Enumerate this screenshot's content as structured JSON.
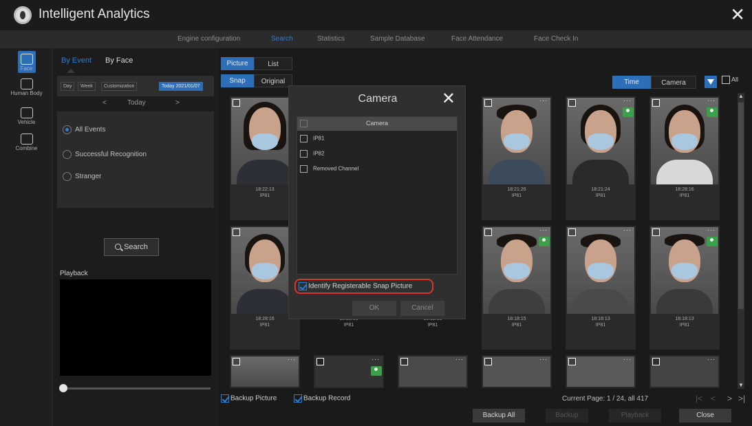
{
  "app": {
    "title": "Intelligent Analytics"
  },
  "nav": {
    "tabs": [
      "Engine configuration",
      "Search",
      "Statistics",
      "Sample Database",
      "Face Attendance",
      "Face Check In"
    ],
    "active": "Search"
  },
  "sidebar": {
    "items": [
      "Face",
      "Human Body",
      "Vehicle",
      "Combine"
    ],
    "active": "Face"
  },
  "panel": {
    "tab_event": "By Event",
    "tab_face": "By Face",
    "range_buttons": [
      "Day",
      "Week",
      "Customization",
      "Today 2021/01/07"
    ],
    "date_label": "Today",
    "prev": "<",
    "next": ">",
    "radio": [
      "All Events",
      "Successful Recognition",
      "Stranger"
    ],
    "radio_selected": "All Events",
    "search_label": "Search",
    "playback_label": "Playback"
  },
  "main": {
    "view_tabs": [
      "Picture",
      "List"
    ],
    "image_tabs": [
      "Snap",
      "Original"
    ],
    "sort_tabs": [
      "Time",
      "Camera"
    ],
    "all_label": "All",
    "thumbs_row1": [
      {
        "time": "18:22:13",
        "cam": "IP81"
      },
      {
        "time": "18:21:26",
        "cam": "IP81"
      },
      {
        "time": "18:21:24",
        "cam": "IP81"
      },
      {
        "time": "18:28:16",
        "cam": "IP81"
      }
    ],
    "thumbs_row2": [
      {
        "time": "18:28:16",
        "cam": "IP81"
      },
      {
        "time": "18:28:06",
        "cam": "IP81"
      },
      {
        "time": "18:12:16",
        "cam": "IP81"
      },
      {
        "time": "18:18:15",
        "cam": "IP81"
      },
      {
        "time": "18:18:13",
        "cam": "IP81"
      },
      {
        "time": "18:18:13",
        "cam": "IP81"
      }
    ],
    "thumb_menu": "···",
    "backup_picture": "Backup Picture",
    "backup_record": "Backup Record",
    "page_info": "Current Page: 1 / 24, all 417",
    "buttons": [
      "Backup All",
      "Backup",
      "Playback",
      "Close"
    ]
  },
  "modal": {
    "title": "Camera",
    "list_header": "Camera",
    "cameras": [
      "IP81",
      "IP82",
      "Removed Channel"
    ],
    "identify_label": "Identify Registerable Snap Picture",
    "ok": "OK",
    "cancel": "Cancel"
  },
  "colors": {
    "accent": "#2c6fb8",
    "highlight": "#d9352a"
  }
}
